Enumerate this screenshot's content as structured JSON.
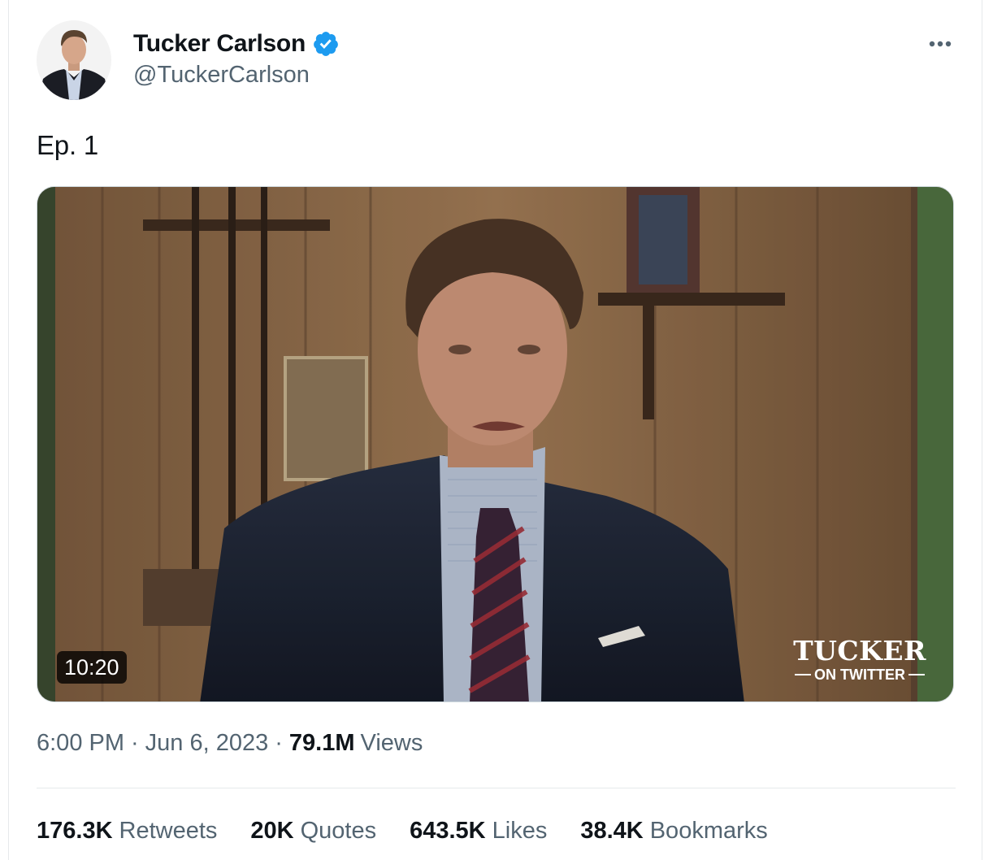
{
  "author": {
    "name": "Tucker Carlson",
    "handle": "@TuckerCarlson",
    "verified": true,
    "verified_color": "#1d9bf0"
  },
  "tweet": {
    "text": "Ep. 1"
  },
  "media": {
    "type": "video",
    "duration": "10:20",
    "brand_main": "TUCKER",
    "brand_sub": "ON TWITTER"
  },
  "meta": {
    "time": "6:00 PM",
    "separator": "·",
    "date": "Jun 6, 2023",
    "views_count": "79.1M",
    "views_label": "Views"
  },
  "stats": [
    {
      "count": "176.3K",
      "label": "Retweets"
    },
    {
      "count": "20K",
      "label": "Quotes"
    },
    {
      "count": "643.5K",
      "label": "Likes"
    },
    {
      "count": "38.4K",
      "label": "Bookmarks"
    }
  ],
  "colors": {
    "text_primary": "#0f1419",
    "text_secondary": "#536471",
    "divider": "#e6e9eb"
  },
  "icons": {
    "more": "more-dots-icon",
    "verified": "verified-badge-icon"
  }
}
